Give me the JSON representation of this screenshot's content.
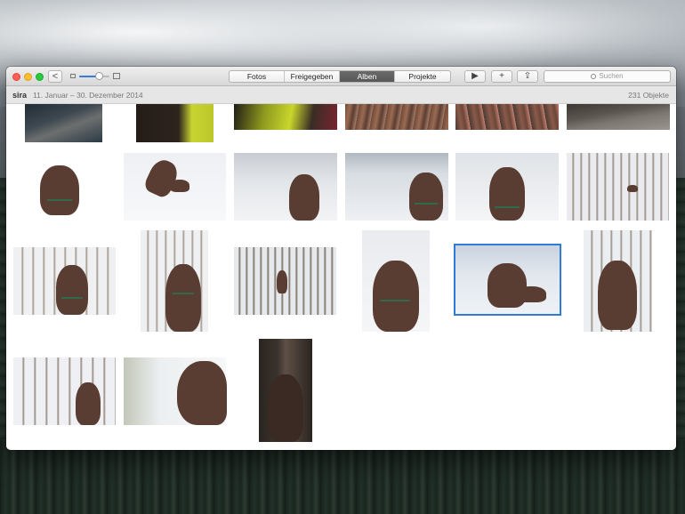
{
  "window": {
    "toolbar": {
      "back_label": "<",
      "segments": [
        "Fotos",
        "Freigegeben",
        "Alben",
        "Projekte"
      ],
      "active_segment": "Alben",
      "play_label": "▶",
      "add_label": "+",
      "share_label": "⇪",
      "search_placeholder": "Suchen",
      "thumbnail_zoom_fraction": 0.65
    },
    "infobar": {
      "album_name": "sira",
      "date_range": "11. Januar – 30. Dezember 2014",
      "item_count": "231 Objekte"
    },
    "photos": {
      "selected_index": 16,
      "count_visible": 21
    },
    "colors": {
      "selection_accent": "#2f7bd6",
      "active_segment_bg": "#5f5f5f",
      "close": "#ff5f57",
      "minimize": "#febc2e",
      "maximize": "#28c840"
    },
    "icons": [
      "back-chevron-icon",
      "small-thumbnail-icon",
      "large-thumbnail-icon",
      "play-icon",
      "plus-icon",
      "share-icon",
      "search-icon"
    ]
  }
}
